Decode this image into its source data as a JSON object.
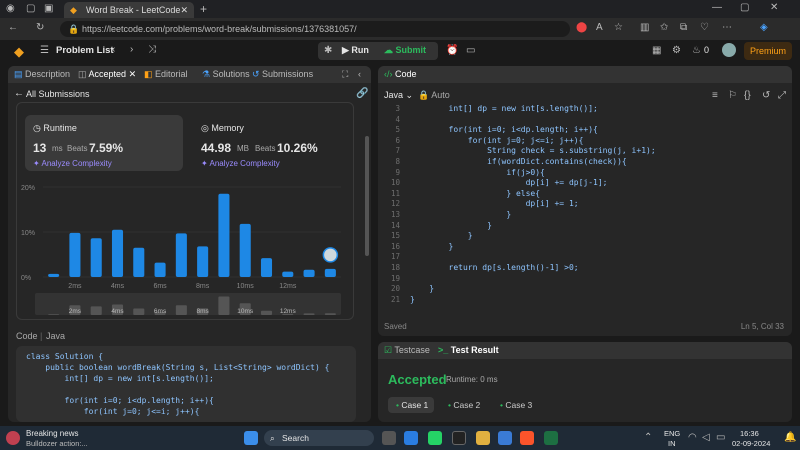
{
  "browser": {
    "tab_title": "Word Break - LeetCode",
    "url": "https://leetcode.com/problems/word-break/submissions/1376381057/"
  },
  "nav": {
    "problem_list": "Problem List",
    "run": "Run",
    "submit": "Submit",
    "streak": "0",
    "premium": "Premium"
  },
  "left": {
    "tabs": [
      "Description",
      "Accepted",
      "Editorial",
      "Solutions",
      "Submissions"
    ],
    "all_submissions": "All Submissions",
    "runtime": {
      "title": "Runtime",
      "value": "13",
      "unit": "ms",
      "beats_label": "Beats",
      "beats": "7.59%",
      "analyze": "Analyze Complexity"
    },
    "memory": {
      "title": "Memory",
      "value": "44.98",
      "unit": "MB",
      "beats_label": "Beats",
      "beats": "10.26%",
      "analyze": "Analyze Complexity"
    },
    "code_label": "Code",
    "lang": "Java",
    "code_lines": [
      "class Solution {",
      "    public boolean wordBreak(String s, List<String> wordDict) {",
      "        int[] dp = new int[s.length()];",
      "",
      "        for(int i=0; i<dp.length; i++){",
      "            for(int j=0; j<=i; j++){"
    ]
  },
  "chart_data": {
    "type": "bar",
    "ylabel_ticks": [
      "20%",
      "10%",
      "0%"
    ],
    "ylim": [
      0,
      20
    ],
    "x_tick_labels": [
      "2ms",
      "4ms",
      "6ms",
      "8ms",
      "10ms",
      "12ms"
    ],
    "values": [
      0.7,
      9.8,
      8.6,
      10.5,
      6.5,
      3.2,
      9.7,
      6.8,
      18.5,
      11.8,
      4.2,
      1.2,
      1.6,
      1.8
    ],
    "highlight_index": 13,
    "mini_ticks": [
      "2ms",
      "4ms",
      "6ms",
      "8ms",
      "10ms",
      "12ms"
    ]
  },
  "editor": {
    "title": "Code",
    "lang": "Java",
    "auto": "Auto",
    "saved": "Saved",
    "cursor": "Ln 5, Col 33",
    "line_numbers": [
      "3",
      "4",
      "5",
      "6",
      "7",
      "8",
      "9",
      "10",
      "11",
      "12",
      "13",
      "14",
      "15",
      "16",
      "17",
      "18",
      "19",
      "20",
      "21"
    ],
    "lines": [
      "        int[] dp = new int[s.length()];",
      "",
      "        for(int i=0; i<dp.length; i++){",
      "            for(int j=0; j<=i; j++){",
      "                String check = s.substring(j, i+1);",
      "                if(wordDict.contains(check)){",
      "                    if(j>0){",
      "                        dp[i] += dp[j-1];",
      "                    } else{",
      "                        dp[i] += 1;",
      "                    }",
      "                }",
      "            }",
      "        }",
      "",
      "        return dp[s.length()-1] >0;",
      "",
      "    }",
      "}"
    ]
  },
  "test": {
    "tab1": "Testcase",
    "tab2": "Test Result",
    "status": "Accepted",
    "runtime": "Runtime: 0 ms",
    "cases": [
      "Case 1",
      "Case 2",
      "Case 3"
    ]
  },
  "taskbar": {
    "news_title": "Breaking news",
    "news_sub": "Bulldozer action:...",
    "search": "Search",
    "lang": "ENG",
    "region": "IN",
    "time": "16:36",
    "date": "02-09-2024"
  }
}
